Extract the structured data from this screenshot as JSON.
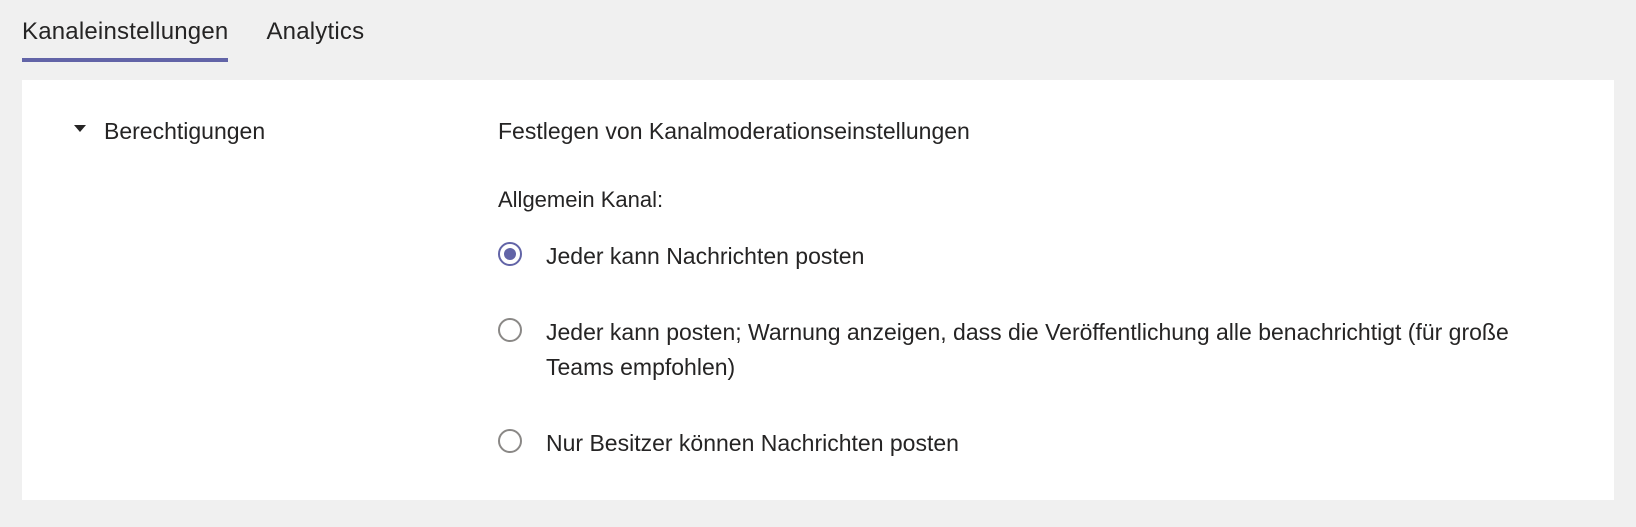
{
  "tabs": [
    {
      "label": "Kanaleinstellungen",
      "active": true
    },
    {
      "label": "Analytics",
      "active": false
    }
  ],
  "section": {
    "title": "Berechtigungen",
    "subtitle": "Festlegen von Kanalmoderationseinstellungen",
    "channel_label": "Allgemein Kanal:",
    "options": [
      {
        "label": "Jeder kann Nachrichten posten",
        "selected": true
      },
      {
        "label": "Jeder kann posten; Warnung anzeigen, dass die Veröffentlichung alle benachrichtigt (für große Teams empfohlen)",
        "selected": false
      },
      {
        "label": "Nur Besitzer können Nachrichten posten",
        "selected": false
      }
    ]
  },
  "colors": {
    "accent": "#6264A7",
    "panel_bg": "#ffffff",
    "page_bg": "#f0f0f0"
  }
}
